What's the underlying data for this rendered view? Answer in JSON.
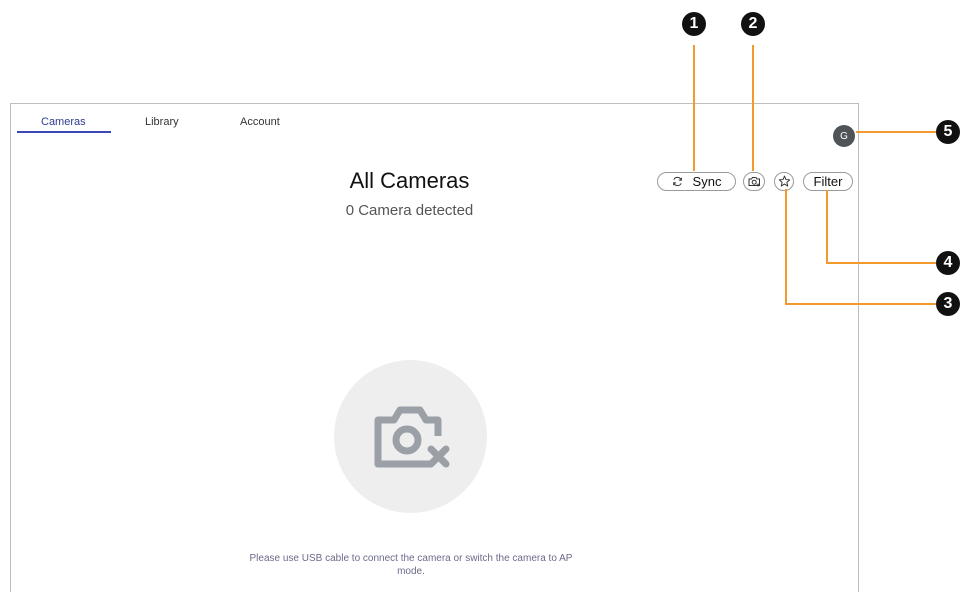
{
  "nav": {
    "tabs": [
      {
        "label": "Cameras",
        "active": true
      },
      {
        "label": "Library",
        "active": false
      },
      {
        "label": "Account",
        "active": false
      }
    ]
  },
  "user": {
    "avatar_initial": "G",
    "avatar_color": "#4e5458"
  },
  "main": {
    "title": "All Cameras",
    "subtitle": "0 Camera detected",
    "empty_message": "Please use USB cable to connect the camera or switch the camera to AP mode."
  },
  "toolbar": {
    "sync_label": "Sync",
    "sync_icon": "refresh-icon",
    "camera_add_icon": "camera-add-icon",
    "favorite_icon": "star-icon",
    "filter_label": "Filter"
  },
  "empty_state": {
    "icon": "camera-off-icon"
  },
  "callouts": [
    "1",
    "2",
    "3",
    "4",
    "5"
  ],
  "colors": {
    "accent": "#3b49b8",
    "callout_line": "#f29a2e",
    "callout_badge": "#111111"
  }
}
